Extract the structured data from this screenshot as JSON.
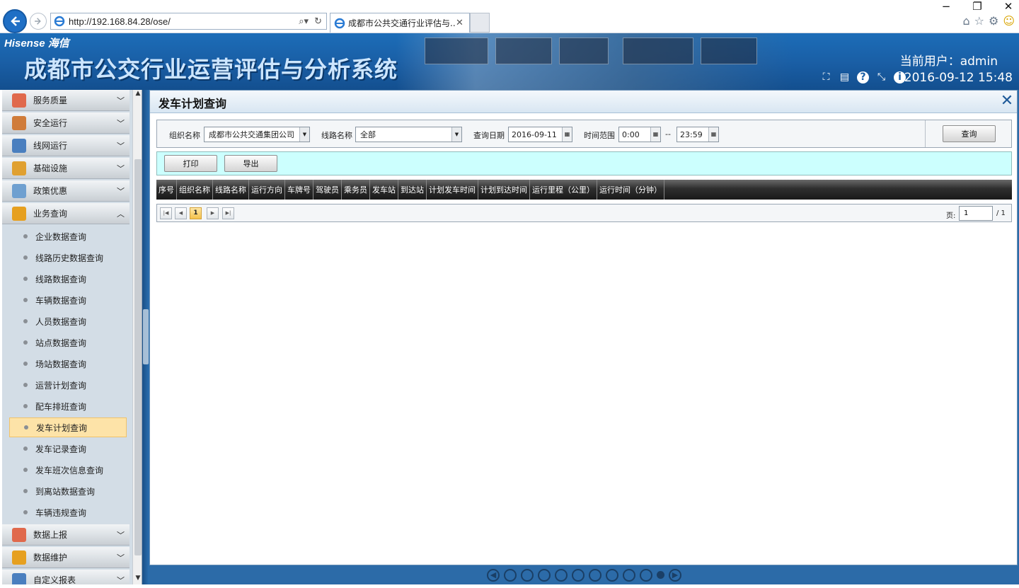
{
  "browser": {
    "url": "http://192.168.84.28/ose/",
    "tab_title": "成都市公共交通行业评估与...",
    "window_controls": [
      "−",
      "❐",
      "✕"
    ],
    "icons": [
      "home-icon",
      "star-icon",
      "settings-icon",
      "smiley-icon"
    ]
  },
  "banner": {
    "brand": "Hisense 海信",
    "system_title": "成都市公交行业运营评估与分析系统",
    "current_user_label": "当前用户：admin",
    "datetime": "2016-09-12 15:48",
    "toolbar_icons": [
      "crop-icon",
      "keyboard-icon",
      "help-icon",
      "resize-icon",
      "info-icon"
    ]
  },
  "sidebar": {
    "groups": [
      {
        "label": "服务质量",
        "icon_color": "#e0694c",
        "expanded": false
      },
      {
        "label": "安全运行",
        "icon_color": "#d07c3a",
        "expanded": false
      },
      {
        "label": "线网运行",
        "icon_color": "#4a7fbf",
        "expanded": false
      },
      {
        "label": "基础设施",
        "icon_color": "#e0a030",
        "expanded": false
      },
      {
        "label": "政策优惠",
        "icon_color": "#6fa0d0",
        "expanded": false
      },
      {
        "label": "业务查询",
        "icon_color": "#e6a020",
        "expanded": true
      }
    ],
    "items": [
      "企业数据查询",
      "线路历史数据查询",
      "线路数据查询",
      "车辆数据查询",
      "人员数据查询",
      "站点数据查询",
      "场站数据查询",
      "运营计划查询",
      "配车排班查询",
      "发车计划查询",
      "发车记录查询",
      "发车班次信息查询",
      "到离站数据查询",
      "车辆违规查询"
    ],
    "active_item": "发车计划查询",
    "bottom_groups": [
      {
        "label": "数据上报",
        "icon_color": "#e0694c"
      },
      {
        "label": "数据维护",
        "icon_color": "#e6a020"
      },
      {
        "label": "自定义报表",
        "icon_color": "#4a7fbf"
      }
    ]
  },
  "panel": {
    "title": "发车计划查询",
    "filter": {
      "org_label": "组织名称",
      "org_value": "成都市公共交通集团公司",
      "line_label": "线路名称",
      "line_value": "全部",
      "date_label": "查询日期",
      "date_value": "2016-09-11",
      "time_label": "时间范围",
      "time_from": "0:00",
      "time_sep": "--",
      "time_to": "23:59",
      "query_button": "查询"
    },
    "actions": {
      "print": "打印",
      "export": "导出"
    },
    "columns": [
      "序号",
      "组织名称",
      "线路名称",
      "运行方向",
      "车牌号",
      "驾驶员",
      "乘务员",
      "发车站",
      "到达站",
      "计划发车时间",
      "计划到达时间",
      "运行里程（公里）",
      "运行时间（分钟）"
    ],
    "pager": {
      "current_page": "1",
      "page_label": "页:",
      "page_input": "1",
      "total": "/ 1"
    }
  },
  "carousel": {
    "dots": 10,
    "active_index": 9
  }
}
